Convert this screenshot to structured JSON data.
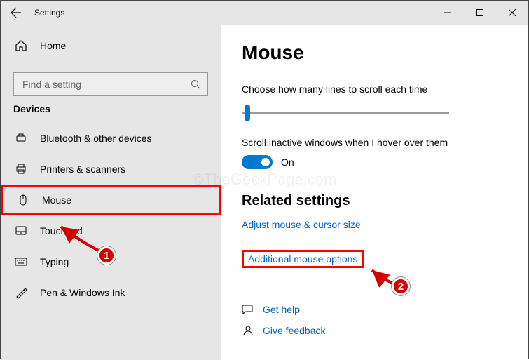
{
  "window": {
    "title": "Settings"
  },
  "sidebar": {
    "home_label": "Home",
    "search_placeholder": "Find a setting",
    "section_title": "Devices",
    "items": [
      {
        "label": "Bluetooth & other devices"
      },
      {
        "label": "Printers & scanners"
      },
      {
        "label": "Mouse"
      },
      {
        "label": "Touchpad"
      },
      {
        "label": "Typing"
      },
      {
        "label": "Pen & Windows Ink"
      }
    ]
  },
  "main": {
    "heading": "Mouse",
    "scroll_lines_label": "Choose how many lines to scroll each time",
    "scroll_inactive_label": "Scroll inactive windows when I hover over them",
    "toggle_state": "On",
    "related_heading": "Related settings",
    "link_adjust": "Adjust mouse & cursor size",
    "link_additional": "Additional mouse options",
    "help_label": "Get help",
    "feedback_label": "Give feedback"
  },
  "annotations": {
    "marker1": "1",
    "marker2": "2"
  },
  "watermark": "©TheGeekPage.com"
}
